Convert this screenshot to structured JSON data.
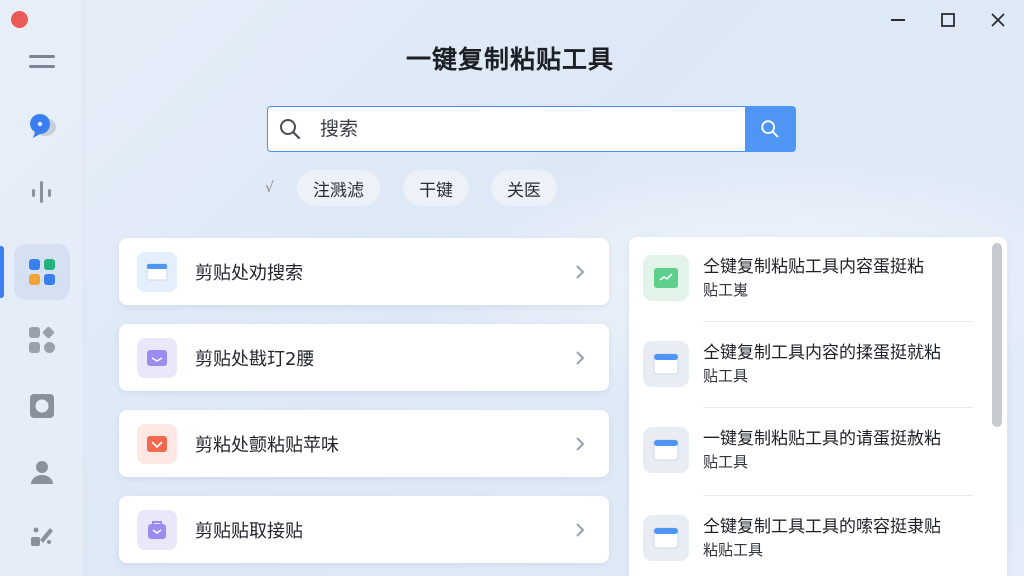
{
  "app": {
    "title": "一键复制粘贴工具"
  },
  "search": {
    "placeholder": "搜索"
  },
  "filters": [
    {
      "label": "注溅滤"
    },
    {
      "label": "干键"
    },
    {
      "label": "关医"
    }
  ],
  "filter_mark": "√",
  "cards": [
    {
      "label": "剪贴处劝搜索",
      "icon": "clipboard-blue-icon"
    },
    {
      "label": "剪贴处戡玎2腰",
      "icon": "mail-purple-icon"
    },
    {
      "label": "剪粘处颤粘贴苹味",
      "icon": "envelope-red-icon"
    },
    {
      "label": "剪贴贴取接贴",
      "icon": "bag-purple-icon"
    }
  ],
  "results": [
    {
      "title": "仝键复制粘贴工具内容蛋挺粘",
      "sub": "贴工嵬",
      "icon": "image-green-icon"
    },
    {
      "title": "仝键复制工具内容的揉蛋挺就粘",
      "sub": "贴工具",
      "icon": "clipboard-blue-icon"
    },
    {
      "title": "一键复制粘贴工具的请蛋挺赦粘",
      "sub": "贴工具",
      "icon": "clipboard-blue-icon"
    },
    {
      "title": "仝键复制工具工具的嗦容挺隶贴",
      "sub": "粘贴工具",
      "icon": "clipboard-blue-icon"
    }
  ],
  "colors": {
    "accent": "#4f95f3",
    "close": "#ec5a57"
  }
}
